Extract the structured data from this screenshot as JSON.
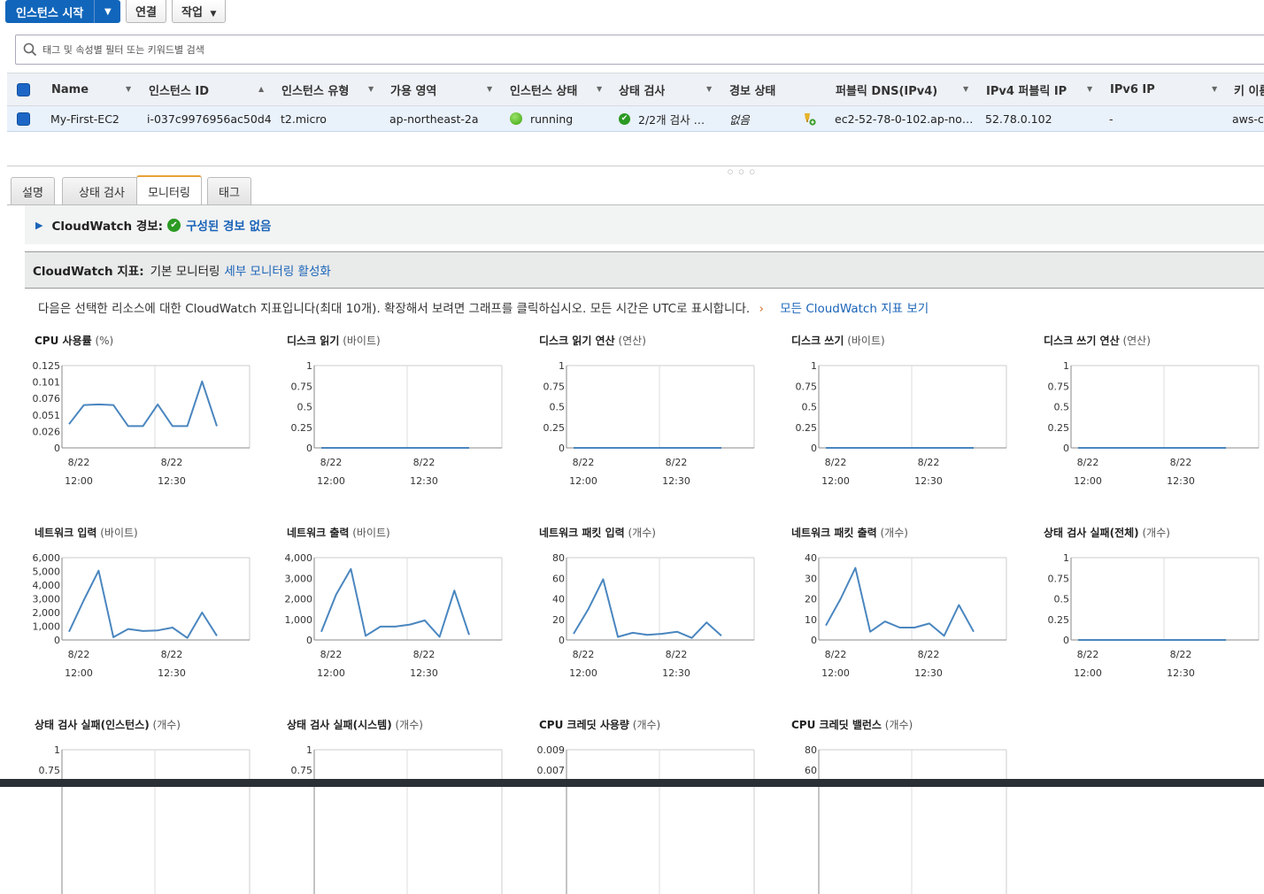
{
  "toolbar": {
    "launch": "인스턴스 시작",
    "connect": "연결",
    "actions": "작업"
  },
  "search": {
    "placeholder": "태그 및 속성별 필터 또는 키워드별 검색"
  },
  "table": {
    "headers": [
      "Name",
      "인스턴스 ID",
      "인스턴스 유형",
      "가용 영역",
      "인스턴스 상태",
      "상태 검사",
      "경보 상태",
      "퍼블릭 DNS(IPv4)",
      "IPv4 퍼블릭 IP",
      "IPv6 IP",
      "키 이름"
    ],
    "row": {
      "name": "My-First-EC2",
      "id": "i-037c9976956ac50d4",
      "type": "t2.micro",
      "zone": "ap-northeast-2a",
      "state": "running",
      "check": "2/2개 검사 …",
      "alarm": "없음",
      "dns": "ec2-52-78-0-102.ap-no…",
      "ipv4": "52.78.0.102",
      "ipv6": "-",
      "key": "aws-c"
    }
  },
  "tabs": [
    "설명",
    "상태 검사",
    "모니터링",
    "태그"
  ],
  "alarm": {
    "label": "CloudWatch 경보:",
    "link": "구성된 경보 없음"
  },
  "metrics": {
    "label": "CloudWatch 지표:",
    "basic": "기본 모니터링",
    "link": "세부 모니터링 활성화"
  },
  "desc": {
    "text": "다음은 선택한 리소스에 대한 CloudWatch 지표입니다(최대 10개). 확장해서 보려면 그래프를 클릭하십시오. 모든 시간은 UTC로 표시합니다.",
    "link": "모든 CloudWatch 지표 보기"
  },
  "colors": {
    "line": "#4a86bf",
    "primary": "#1166bb",
    "link": "#1a64b8"
  },
  "chart_data": [
    {
      "type": "line",
      "title": "CPU 사용률",
      "unit": "(%)",
      "yticks": [
        "0.125",
        "0.101",
        "0.076",
        "0.051",
        "0.026",
        "0"
      ],
      "ylim": [
        0,
        0.125
      ],
      "xticks": [
        [
          "8/22",
          "12:00"
        ],
        [
          "8/22",
          "12:30"
        ]
      ],
      "values": [
        0.036,
        0.065,
        0.066,
        0.065,
        0.033,
        0.033,
        0.066,
        0.033,
        0.033,
        0.101,
        0.033
      ]
    },
    {
      "type": "line",
      "title": "디스크 읽기",
      "unit": "(바이트)",
      "yticks": [
        "1",
        "0.75",
        "0.5",
        "0.25",
        "0"
      ],
      "ylim": [
        0,
        1
      ],
      "xticks": [
        [
          "8/22",
          "12:00"
        ],
        [
          "8/22",
          "12:30"
        ]
      ],
      "values": [
        0,
        0,
        0,
        0,
        0,
        0,
        0,
        0,
        0,
        0,
        0
      ]
    },
    {
      "type": "line",
      "title": "디스크 읽기 연산",
      "unit": "(연산)",
      "yticks": [
        "1",
        "0.75",
        "0.5",
        "0.25",
        "0"
      ],
      "ylim": [
        0,
        1
      ],
      "xticks": [
        [
          "8/22",
          "12:00"
        ],
        [
          "8/22",
          "12:30"
        ]
      ],
      "values": [
        0,
        0,
        0,
        0,
        0,
        0,
        0,
        0,
        0,
        0,
        0
      ]
    },
    {
      "type": "line",
      "title": "디스크 쓰기",
      "unit": "(바이트)",
      "yticks": [
        "1",
        "0.75",
        "0.5",
        "0.25",
        "0"
      ],
      "ylim": [
        0,
        1
      ],
      "xticks": [
        [
          "8/22",
          "12:00"
        ],
        [
          "8/22",
          "12:30"
        ]
      ],
      "values": [
        0,
        0,
        0,
        0,
        0,
        0,
        0,
        0,
        0,
        0,
        0
      ]
    },
    {
      "type": "line",
      "title": "디스크 쓰기 연산",
      "unit": "(연산)",
      "yticks": [
        "1",
        "0.75",
        "0.5",
        "0.25",
        "0"
      ],
      "ylim": [
        0,
        1
      ],
      "xticks": [
        [
          "8/22",
          "12:00"
        ],
        [
          "8/22",
          "12:30"
        ]
      ],
      "values": [
        0,
        0,
        0,
        0,
        0,
        0,
        0,
        0,
        0,
        0,
        0
      ]
    },
    {
      "type": "line",
      "title": "네트워크 입력",
      "unit": "(바이트)",
      "yticks": [
        "6,000",
        "5,000",
        "4,000",
        "3,000",
        "2,000",
        "1,000",
        "0"
      ],
      "ylim": [
        0,
        6000
      ],
      "xticks": [
        [
          "8/22",
          "12:00"
        ],
        [
          "8/22",
          "12:30"
        ]
      ],
      "values": [
        600,
        2900,
        5050,
        200,
        800,
        650,
        700,
        900,
        150,
        2000,
        300
      ]
    },
    {
      "type": "line",
      "title": "네트워크 출력",
      "unit": "(바이트)",
      "yticks": [
        "4,000",
        "3,000",
        "2,000",
        "1,000",
        "0"
      ],
      "ylim": [
        0,
        4000
      ],
      "xticks": [
        [
          "8/22",
          "12:00"
        ],
        [
          "8/22",
          "12:30"
        ]
      ],
      "values": [
        400,
        2200,
        3450,
        200,
        650,
        650,
        750,
        950,
        150,
        2400,
        250
      ]
    },
    {
      "type": "line",
      "title": "네트워크 패킷 입력",
      "unit": "(개수)",
      "yticks": [
        "80",
        "60",
        "40",
        "20",
        "0"
      ],
      "ylim": [
        0,
        80
      ],
      "xticks": [
        [
          "8/22",
          "12:00"
        ],
        [
          "8/22",
          "12:30"
        ]
      ],
      "values": [
        6,
        30,
        59,
        3,
        7,
        5,
        6,
        8,
        2,
        17,
        4
      ]
    },
    {
      "type": "line",
      "title": "네트워크 패킷 출력",
      "unit": "(개수)",
      "yticks": [
        "40",
        "30",
        "20",
        "10",
        "0"
      ],
      "ylim": [
        0,
        40
      ],
      "xticks": [
        [
          "8/22",
          "12:00"
        ],
        [
          "8/22",
          "12:30"
        ]
      ],
      "values": [
        7,
        20,
        35,
        4,
        9,
        6,
        6,
        8,
        2,
        17,
        4
      ]
    },
    {
      "type": "line",
      "title": "상태 검사 실패(전체)",
      "unit": "(개수)",
      "yticks": [
        "1",
        "0.75",
        "0.5",
        "0.25",
        "0"
      ],
      "ylim": [
        0,
        1
      ],
      "xticks": [
        [
          "8/22",
          "12:00"
        ],
        [
          "8/22",
          "12:30"
        ]
      ],
      "values": [
        0,
        0,
        0,
        0,
        0,
        0,
        0,
        0,
        0,
        0,
        0
      ]
    },
    {
      "type": "line",
      "title": "상태 검사 실패(인스턴스)",
      "unit": "(개수)",
      "yticks": [
        "1",
        "0.75"
      ],
      "ylim": [
        0,
        1
      ],
      "xticks": [],
      "values": []
    },
    {
      "type": "line",
      "title": "상태 검사 실패(시스템)",
      "unit": "(개수)",
      "yticks": [
        "1",
        "0.75"
      ],
      "ylim": [
        0,
        1
      ],
      "xticks": [],
      "values": []
    },
    {
      "type": "line",
      "title": "CPU 크레딧 사용량",
      "unit": "(개수)",
      "yticks": [
        "0.009",
        "0.007"
      ],
      "ylim": [
        0,
        0.009
      ],
      "xticks": [],
      "values": []
    },
    {
      "type": "line",
      "title": "CPU 크레딧 밸런스",
      "unit": "(개수)",
      "yticks": [
        "80",
        "60"
      ],
      "ylim": [
        0,
        80
      ],
      "xticks": [],
      "values": []
    }
  ]
}
